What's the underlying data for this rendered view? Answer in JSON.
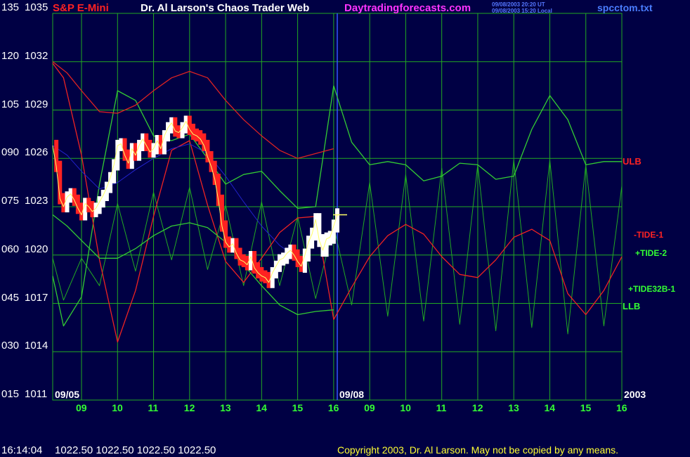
{
  "header": {
    "instrument": "S&P E-Mini",
    "title": "Dr. Al Larson's Chaos Trader Web",
    "site": "Daytradingforecasts.com",
    "times": [
      "09/08/2003 20:20 UT",
      "09/08/2003 15:20 Local"
    ],
    "file": "spcctom.txt"
  },
  "footer": {
    "last_time": "16:14:04",
    "ohlc": "1022.50 1022.50 1022.50 1022.50",
    "copyright": "Copyright 2003, Dr. Al Larson. May not be copied by any means."
  },
  "colors": {
    "background": "#000044",
    "grid": "#22aa22",
    "price": "#ffffff",
    "price_down": "#ff2222",
    "ulb": "#dd2222",
    "llb": "#33cc33",
    "tide1": "#ee2222",
    "tide2": "#33cc33",
    "tide32b": "#22aa22",
    "ma": "#2222cc",
    "mid": "#ffff66"
  },
  "chart_data": {
    "type": "line",
    "title": "S&P E-Mini",
    "y_left_labels": [
      "135",
      "120",
      "105",
      "090",
      "075",
      "060",
      "045",
      "030",
      "015"
    ],
    "y_price_labels": [
      "1035",
      "1032",
      "1029",
      "1026",
      "1023",
      "1020",
      "1017",
      "1014",
      "1011"
    ],
    "ylim": [
      1011,
      1035
    ],
    "x_hour_labels": [
      "09",
      "10",
      "11",
      "12",
      "13",
      "14",
      "15",
      "16",
      "09",
      "10",
      "11",
      "12",
      "13",
      "14",
      "15",
      "16"
    ],
    "date_labels": [
      "09/05",
      "09/08"
    ],
    "year_label": "2003",
    "x_hours": [
      8.2,
      16.1
    ],
    "series_labels": {
      "ulb": "ULB",
      "tide1": "-TIDE-1",
      "tide2": "+TIDE-2",
      "tide32b": "+TIDE32B-1",
      "llb": "LLB"
    },
    "price_0905": {
      "x": [
        8.2,
        8.3,
        8.4,
        8.5,
        8.6,
        8.7,
        8.8,
        8.9,
        9.0,
        9.1,
        9.2,
        9.3,
        9.4,
        9.5,
        9.6,
        9.7,
        9.8,
        9.9,
        10.0,
        10.1,
        10.2,
        10.3,
        10.4,
        10.5,
        10.6,
        10.7,
        10.8,
        10.9,
        11.0,
        11.1,
        11.2,
        11.3,
        11.4,
        11.5,
        11.6,
        11.7,
        11.8,
        11.9,
        12.0,
        12.1,
        12.2,
        12.3,
        12.4,
        12.5,
        12.6,
        12.7,
        12.8,
        12.9,
        13.0,
        13.1,
        13.2,
        13.3,
        13.4,
        13.5,
        13.6,
        13.7,
        13.8,
        13.9,
        14.0,
        14.1,
        14.2,
        14.3,
        14.4,
        14.5,
        14.6,
        14.7,
        14.8,
        14.9,
        15.0,
        15.1
      ],
      "y": [
        1026.8,
        1025.5,
        1023.5,
        1023.0,
        1023.6,
        1023.8,
        1023.4,
        1022.9,
        1022.5,
        1023.2,
        1023.0,
        1022.7,
        1022.9,
        1023.3,
        1023.7,
        1024.2,
        1024.8,
        1025.6,
        1026.8,
        1026.9,
        1026.2,
        1025.7,
        1026.6,
        1026.2,
        1026.8,
        1027.2,
        1026.8,
        1026.4,
        1026.6,
        1027.1,
        1026.6,
        1027.4,
        1027.9,
        1028.2,
        1027.7,
        1027.6,
        1027.9,
        1028.3,
        1027.8,
        1027.5,
        1027.4,
        1027.2,
        1026.8,
        1026.1,
        1025.5,
        1024.7,
        1023.4,
        1021.8,
        1020.8,
        1020.5,
        1020.7,
        1020.1,
        1019.7,
        1019.6,
        1019.4,
        1019.9,
        1019.2,
        1018.9,
        1018.7,
        1018.6,
        1018.3,
        1018.9,
        1019.3,
        1019.7,
        1019.8,
        1020.1,
        1020.3,
        1020.0,
        1019.6,
        1019.3
      ]
    },
    "price_0908": {
      "x": [
        15.1,
        15.2,
        15.3,
        15.4,
        15.5,
        15.6,
        15.7,
        15.8,
        15.9,
        16.0,
        16.1
      ],
      "y": [
        1019.3,
        1020.0,
        1020.8,
        1021.3,
        1022.2,
        1020.9,
        1020.3,
        1021.0,
        1021.1,
        1021.8,
        1022.5
      ]
    },
    "ulb": {
      "x": [
        8.2,
        8.6,
        9.0,
        9.5,
        10.0,
        10.5,
        11.0,
        11.5,
        12.0,
        12.5,
        13.0,
        13.5,
        14.0,
        14.5,
        15.0,
        15.5,
        16.0
      ],
      "y": [
        1032.0,
        1031.3,
        1030.2,
        1028.9,
        1028.8,
        1029.3,
        1030.2,
        1031.0,
        1031.4,
        1031.0,
        1029.6,
        1028.4,
        1027.4,
        1026.5,
        1026.0,
        1026.3,
        1026.6
      ]
    },
    "llb": {
      "x": [
        8.2,
        8.6,
        9.0,
        9.5,
        10.0,
        10.5,
        11.0,
        11.5,
        12.0,
        12.5,
        13.0,
        13.5,
        14.0,
        14.5,
        15.0,
        15.5,
        16.0
      ],
      "y": [
        1022.5,
        1021.8,
        1020.9,
        1019.8,
        1019.8,
        1020.4,
        1021.2,
        1021.8,
        1022.0,
        1021.7,
        1020.8,
        1019.4,
        1018.1,
        1016.9,
        1016.3,
        1016.5,
        1016.6
      ]
    },
    "tide1": {
      "x": [
        8.2,
        8.5,
        9.0,
        9.5,
        10.0,
        10.5,
        11.0,
        11.5,
        12.0,
        12.5,
        13.0,
        13.5,
        14.0,
        14.5,
        15.0,
        15.5,
        16.0,
        16.5,
        17.0,
        17.5,
        18.0,
        18.5,
        19.0,
        19.5,
        20.0,
        20.5,
        21.0,
        21.5,
        22.0,
        22.5,
        23.0,
        23.5,
        24.0
      ],
      "y": [
        1031.9,
        1031.0,
        1026.2,
        1019.7,
        1014.6,
        1017.8,
        1022.4,
        1026.5,
        1027.1,
        1023.1,
        1019.6,
        1018.3,
        1019.8,
        1021.4,
        1022.3,
        1022.4,
        1016.0,
        1018.0,
        1019.9,
        1021.2,
        1021.9,
        1021.3,
        1019.9,
        1018.8,
        1018.6,
        1019.7,
        1021.1,
        1021.6,
        1020.9,
        1017.6,
        1016.3,
        1017.8,
        1019.9
      ]
    },
    "tide2": {
      "x": [
        8.2,
        8.5,
        9.0,
        9.5,
        10.0,
        10.5,
        11.0,
        11.5,
        12.0,
        12.5,
        13.0,
        13.5,
        14.0,
        14.5,
        15.0,
        15.5,
        16.0,
        16.5,
        17.0,
        17.5,
        18.0,
        18.5,
        19.0,
        19.5,
        20.0,
        20.5,
        21.0,
        21.5,
        22.0,
        22.5,
        23.0,
        23.5,
        24.0
      ],
      "y": [
        1018.7,
        1015.6,
        1017.4,
        1024.4,
        1030.2,
        1029.6,
        1027.4,
        1027.1,
        1027.5,
        1026.0,
        1024.4,
        1025.0,
        1025.2,
        1024.0,
        1022.9,
        1023.0,
        1030.5,
        1027.0,
        1025.6,
        1025.8,
        1025.6,
        1024.6,
        1024.9,
        1025.7,
        1025.6,
        1024.7,
        1024.9,
        1027.8,
        1029.9,
        1028.4,
        1025.6,
        1025.8,
        1025.8
      ]
    },
    "tide32b": {
      "x": [
        8.2,
        8.5,
        9.0,
        9.5,
        10.0,
        10.5,
        11.0,
        11.5,
        12.0,
        12.5,
        13.0,
        13.5,
        14.0,
        14.5,
        15.0,
        15.5,
        16.0,
        16.5,
        17.0,
        17.5,
        18.0,
        18.5,
        19.0,
        19.5,
        20.0,
        20.5,
        21.0,
        21.5,
        22.0,
        22.5,
        23.0,
        23.5,
        24.0
      ],
      "y": [
        1019.8,
        1017.2,
        1019.8,
        1018.1,
        1023.2,
        1019.0,
        1023.9,
        1019.7,
        1024.2,
        1019.1,
        1023.1,
        1018.1,
        1023.3,
        1018.1,
        1022.4,
        1017.3,
        1021.8,
        1016.9,
        1024.5,
        1016.2,
        1025.0,
        1015.9,
        1025.4,
        1015.7,
        1025.6,
        1015.3,
        1025.9,
        1015.5,
        1025.9,
        1015.1,
        1025.6,
        1015.6,
        1024.3
      ]
    },
    "ma": {
      "x": [
        8.2,
        8.6,
        9.0,
        9.5,
        10.0,
        10.5,
        11.0,
        11.5,
        12.0,
        12.5,
        13.0,
        13.5,
        14.0,
        14.5,
        15.0
      ],
      "y": [
        1026.8,
        1026.2,
        1025.2,
        1024.1,
        1024.5,
        1025.3,
        1026.0,
        1026.6,
        1026.9,
        1026.3,
        1024.9,
        1023.3,
        1021.8,
        1020.6,
        1019.8
      ]
    }
  }
}
